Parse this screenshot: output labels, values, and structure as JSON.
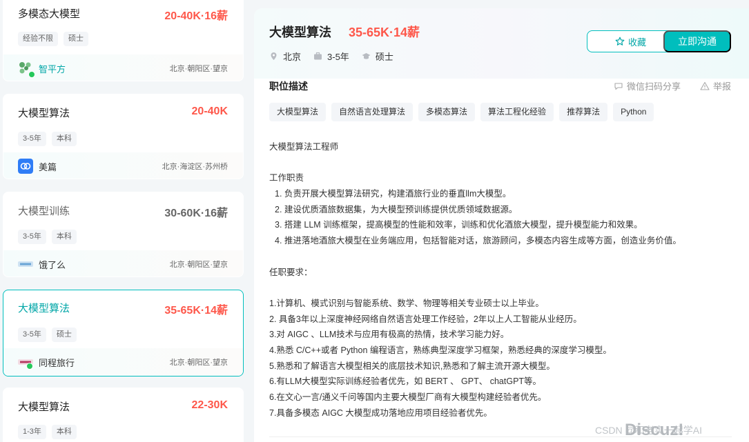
{
  "job_list": [
    {
      "title": "多模态大模型",
      "salary": "20-40K·16薪",
      "tags": [
        "经验不限",
        "硕士"
      ],
      "company": "智平方",
      "location": "北京·朝阳区·望京"
    },
    {
      "title": "大模型算法",
      "salary": "20-40K",
      "tags": [
        "3-5年",
        "本科"
      ],
      "company": "美篇",
      "location": "北京·海淀区·苏州桥"
    },
    {
      "title": "大模型训练",
      "salary": "30-60K·16薪",
      "tags": [
        "3-5年",
        "本科"
      ],
      "company": "饿了么",
      "location": "北京·朝阳区·望京"
    },
    {
      "title": "大模型算法",
      "salary": "35-65K·14薪",
      "tags": [
        "3-5年",
        "硕士"
      ],
      "company": "同程旅行",
      "location": "北京·朝阳区·望京"
    },
    {
      "title": "大模型算法",
      "salary": "22-30K",
      "tags": [
        "1-3年",
        "本科"
      ]
    }
  ],
  "detail": {
    "title": "大模型算法",
    "salary": "35-65K·14薪",
    "city": "北京",
    "experience": "3-5年",
    "degree": "硕士",
    "fav_label": "收藏",
    "chat_label": "立即沟通",
    "section_title": "职位描述",
    "share_label": "微信扫码分享",
    "report_label": "举报",
    "skills": [
      "大模型算法",
      "自然语言处理算法",
      "多模态算法",
      "算法工程化经验",
      "推荐算法",
      "Python"
    ],
    "heading": "大模型算法工程师",
    "duties_title": "工作职责",
    "duties": [
      "1.  负责开展大模型算法研究，构建酒旅行业的垂直llm大模型。",
      "2. 建设优质酒旅数据集，为大模型预训练提供优质领域数据源。",
      "3. 搭建 LLM 训练框架，提高模型的性能和效率，训练和优化酒旅大模型，提升模型能力和效果。",
      "4. 推进落地酒旅大模型在业务端应用，包括智能对话，旅游顾问，多模态内容生成等方面，创造业务价值。"
    ],
    "req_title": "任职要求：",
    "requirements": [
      "1.计算机、模式识别与智能系统、数学、物理等相关专业硕士以上毕业。",
      "2. 具备3年以上深度神经网络自然语言处理工作经验，2年以上人工智能从业经历。",
      "3.对 AIGC 、LLM技术与应用有极高的热情，技术学习能力好。",
      "4.熟悉 C/C++或者 Python 编程语言，熟练典型深度学习框架，熟悉经典的深度学习模型。",
      "5.熟悉和了解语言大模型相关的底层技术知识,熟悉和了解主流开源大模型。",
      "6.有LLM大模型实际训练经验者优先，如 BERT 、 GPT、 chatGPT等。",
      "6.在文心一言/通义千问等国内主要大模型厂商有大模型构建经验者优先。",
      "7.具备多模态 AIGC 大模型成功落地应用项目经验者优先。"
    ]
  },
  "watermark": {
    "text": "CSDN @和老实一起学AI",
    "brand": "Discuz!"
  },
  "colors": {
    "accent": "#00bebd",
    "salary": "#fe574a"
  }
}
